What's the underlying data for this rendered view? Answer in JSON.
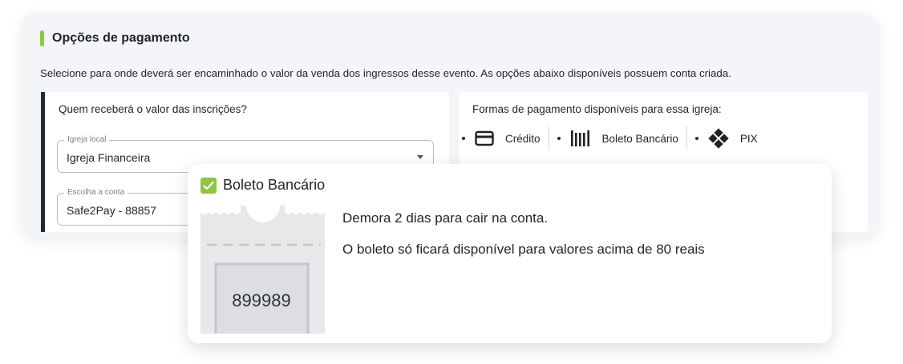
{
  "section": {
    "title": "Opções de pagamento",
    "description": "Selecione para onde deverá ser encaminhado o valor da venda dos ingressos desse evento. As opções abaixo disponíveis possuem conta criada."
  },
  "recipient": {
    "question": "Quem receberá o valor das inscrições?",
    "church_field": {
      "legend": "Igreja local",
      "value": "Igreja Financeira"
    },
    "account_field": {
      "legend": "Escolha a conta",
      "value": "Safe2Pay - 88857"
    }
  },
  "methods": {
    "title": "Formas de pagamento disponíveis para essa igreja:",
    "items": [
      {
        "label": "Crédito",
        "icon": "credit-card-icon"
      },
      {
        "label": "Boleto Bancário",
        "icon": "barcode-icon"
      },
      {
        "label": "PIX",
        "icon": "pix-icon"
      }
    ]
  },
  "popup": {
    "checked": true,
    "title": "Boleto Bancário",
    "delay": "Demora 2 dias para cair na conta.",
    "note": "O boleto só ficará disponível para valores acima de 80 reais",
    "ticket_code": "899989"
  },
  "colors": {
    "accent": "#8dc63f",
    "dark_border": "#1f2a37"
  }
}
